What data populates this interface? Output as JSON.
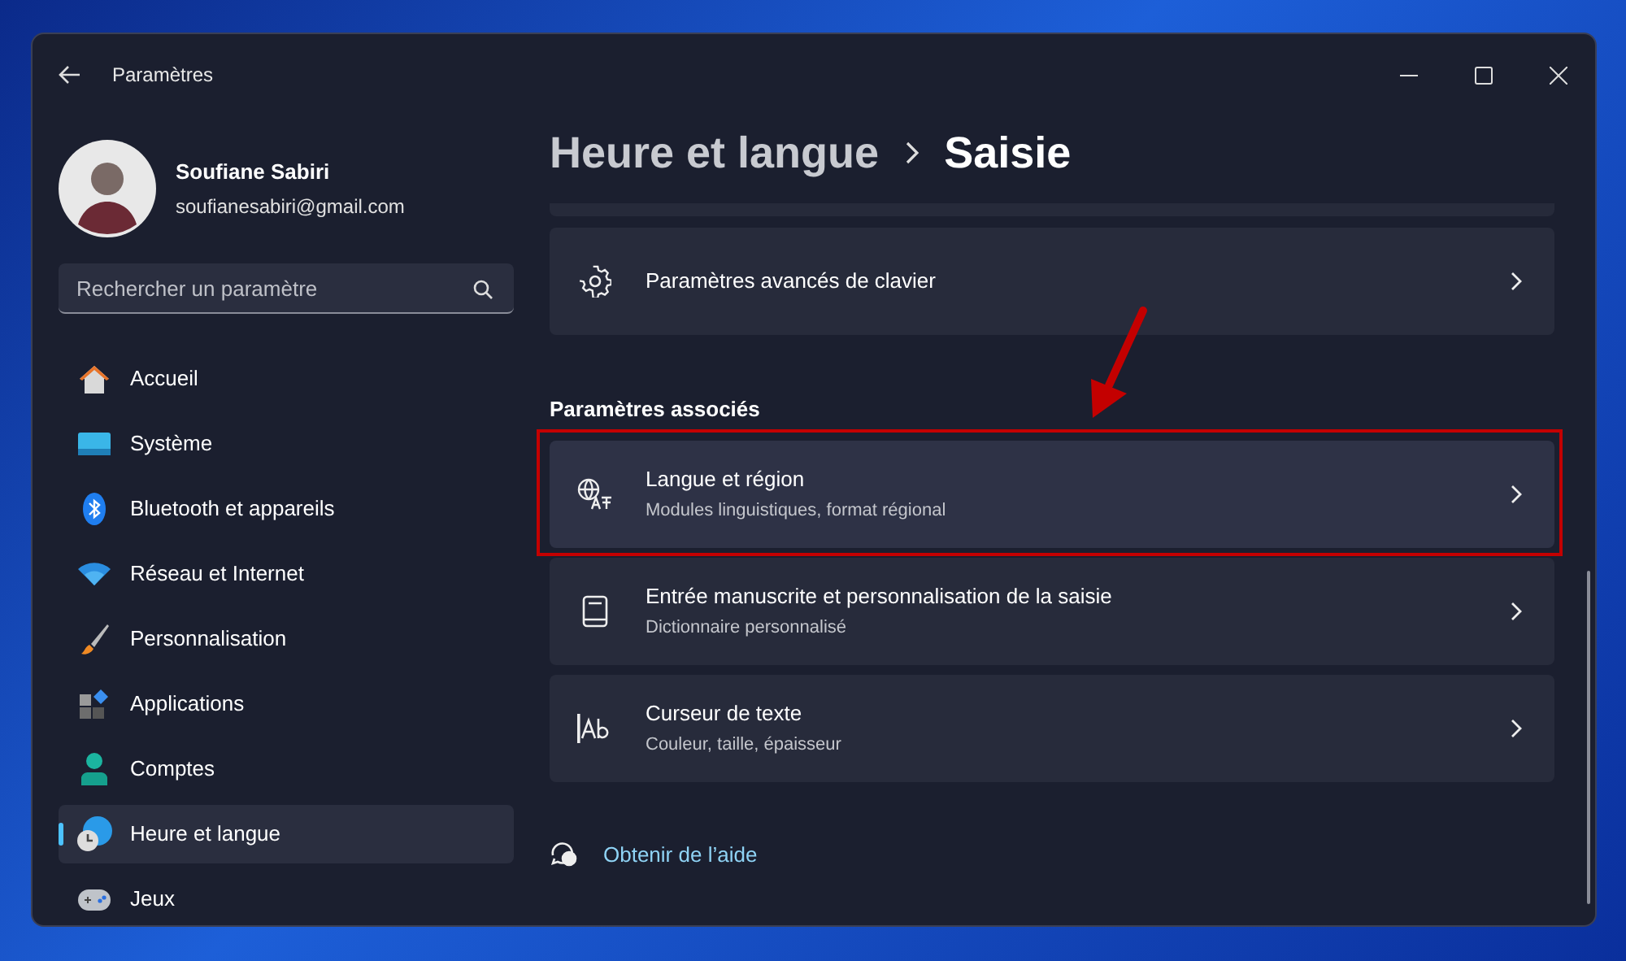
{
  "window": {
    "title": "Paramètres"
  },
  "account": {
    "name": "Soufiane Sabiri",
    "email": "soufianesabiri@gmail.com"
  },
  "search": {
    "placeholder": "Rechercher un paramètre"
  },
  "nav": [
    {
      "label": "Accueil",
      "kind": "home",
      "selected": false
    },
    {
      "label": "Système",
      "kind": "system",
      "selected": false
    },
    {
      "label": "Bluetooth et appareils",
      "kind": "bluetooth",
      "selected": false
    },
    {
      "label": "Réseau et Internet",
      "kind": "wifi",
      "selected": false
    },
    {
      "label": "Personnalisation",
      "kind": "brush",
      "selected": false
    },
    {
      "label": "Applications",
      "kind": "apps",
      "selected": false
    },
    {
      "label": "Comptes",
      "kind": "person",
      "selected": false
    },
    {
      "label": "Heure et langue",
      "kind": "time",
      "selected": true
    },
    {
      "label": "Jeux",
      "kind": "gamepad",
      "selected": false
    }
  ],
  "breadcrumb": [
    "Heure et langue",
    "Saisie"
  ],
  "cards": [
    {
      "title": "Paramètres avancés de clavier",
      "kind": "gear",
      "highlighted": false
    }
  ],
  "related": {
    "title": "Paramètres associés",
    "cards": [
      {
        "title": "Langue et région",
        "subtitle": "Modules linguistiques, format régional",
        "kind": "language",
        "highlighted": true
      },
      {
        "title": "Entrée manuscrite et personnalisation de la saisie",
        "subtitle": "Dictionnaire personnalisé",
        "kind": "book",
        "highlighted": false
      },
      {
        "title": "Curseur de texte",
        "subtitle": "Couleur, taille, épaisseur",
        "kind": "cursor",
        "highlighted": false
      }
    ]
  },
  "help": {
    "label": "Obtenir de l’aide"
  }
}
